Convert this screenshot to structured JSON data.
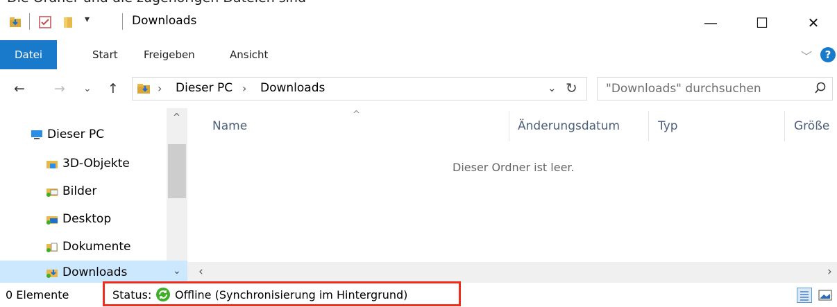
{
  "top_caption": "Die Ordner und die zugehörigen Dateien sind",
  "window": {
    "title": "Downloads",
    "controls": {
      "minimize": "—",
      "maximize": "☐",
      "close": "✕"
    }
  },
  "ribbon": {
    "tabs": [
      {
        "label": "Datei",
        "active": true
      },
      {
        "label": "Start"
      },
      {
        "label": "Freigeben"
      },
      {
        "label": "Ansicht"
      }
    ]
  },
  "address": {
    "path": [
      "Dieser PC",
      "Downloads"
    ],
    "search_placeholder": "\"Downloads\" durchsuchen"
  },
  "nav_pane": {
    "items": [
      {
        "label": "Dieser PC",
        "icon": "pc-icon"
      },
      {
        "label": "3D-Objekte",
        "icon": "3d-objects-folder-icon"
      },
      {
        "label": "Bilder",
        "icon": "pictures-folder-icon"
      },
      {
        "label": "Desktop",
        "icon": "desktop-folder-icon"
      },
      {
        "label": "Dokumente",
        "icon": "documents-folder-icon"
      },
      {
        "label": "Downloads",
        "icon": "downloads-folder-icon",
        "selected": true
      }
    ]
  },
  "columns": [
    "Name",
    "Änderungsdatum",
    "Typ",
    "Größe"
  ],
  "empty_message": "Dieser Ordner ist leer.",
  "status": {
    "count": "0 Elemente",
    "label": "Status:",
    "value": "Offline (Synchronisierung im Hintergrund)"
  },
  "colors": {
    "accent": "#1979ca",
    "highlight": "#ef2b1c",
    "selected": "#cce8ff",
    "sync_green": "#3fae29"
  }
}
